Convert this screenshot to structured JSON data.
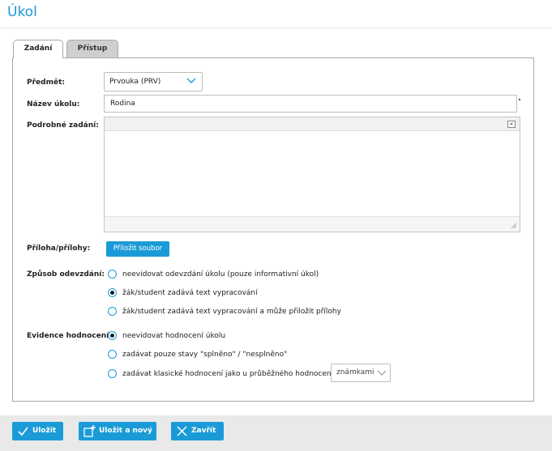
{
  "header": {
    "title": "Úkol"
  },
  "tabs": [
    {
      "label": "Zadání",
      "active": true
    },
    {
      "label": "Přístup",
      "active": false
    }
  ],
  "form": {
    "subject": {
      "label": "Předmět:",
      "value": "Prvouka (PRV)"
    },
    "name": {
      "label": "Název úkolu:",
      "value": "Rodina"
    },
    "description": {
      "label": "Podrobné zadání:",
      "value": ""
    },
    "attachments": {
      "label": "Příloha/přílohy:",
      "button": "Přiložit soubor"
    },
    "submission": {
      "label": "Způsob odevzdání:",
      "options": [
        {
          "label": "neevidovat odevzdání úkolu (pouze informativní úkol)",
          "checked": false
        },
        {
          "label": "žák/student zadává text vypracování",
          "checked": true
        },
        {
          "label": "žák/student zadává text vypracování a může přiložit přílohy",
          "checked": false
        }
      ]
    },
    "grading": {
      "label": "Evidence hodnocení:",
      "options": [
        {
          "label": "neevidovat hodnocení úkolu",
          "checked": true
        },
        {
          "label": "zadávat pouze stavy \"splněno\" / \"nesplněno\"",
          "checked": false
        },
        {
          "label": "zadávat klasické hodnocení jako u průběžného hodnocení a to",
          "checked": false
        }
      ],
      "mode_select": "známkami"
    }
  },
  "footer": {
    "save": "Uložit",
    "save_new": "Uložit a nový",
    "close": "Zavřít"
  },
  "colors": {
    "accent": "#1a9bd7",
    "title": "#1f95d6",
    "footer_bg": "#e9e9e9"
  }
}
